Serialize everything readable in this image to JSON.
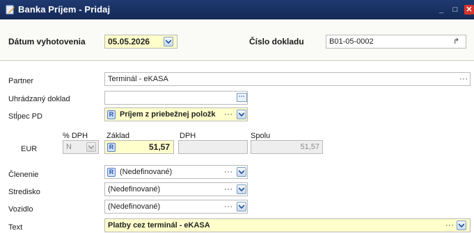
{
  "window": {
    "title": "Banka Príjem - Pridaj",
    "minimize": "_",
    "maximize": "□",
    "close": "✕"
  },
  "header": {
    "date_label": "Dátum vyhotovenia",
    "date_value": "05.05.2026",
    "doc_label": "Číslo dokladu",
    "doc_value": "B01-05-0002"
  },
  "form": {
    "partner": {
      "label": "Partner",
      "value": "Terminál - eKASA",
      "more": "···"
    },
    "paid_doc": {
      "label": "Uhrádzaný doklad",
      "value": "",
      "more": "···"
    },
    "column": {
      "label": "Stĺpec PD",
      "badge": "R",
      "value": "Príjem z priebežnej položk",
      "more": "···"
    },
    "amounts": {
      "currency": "EUR",
      "vat_pct_header": "% DPH",
      "vat_pct_value": "N",
      "base_header": "Základ",
      "base_badge": "R",
      "base_value": "51,57",
      "vat_header": "DPH",
      "vat_value": "",
      "total_header": "Spolu",
      "total_value": "51,57"
    },
    "division": {
      "label": "Členenie",
      "badge": "R",
      "value": "(Nedefinované)",
      "more": "···"
    },
    "center": {
      "label": "Stredisko",
      "value": "(Nedefinované)",
      "more": "···"
    },
    "vehicle": {
      "label": "Vozidlo",
      "value": "(Nedefinované)",
      "more": "···"
    },
    "text": {
      "label": "Text",
      "value": "Platby cez terminál - eKASA",
      "more": "···"
    }
  },
  "colors": {
    "titlebar": "#1f3a72",
    "highlight_field": "#ffffcc",
    "close": "#d9342b"
  }
}
